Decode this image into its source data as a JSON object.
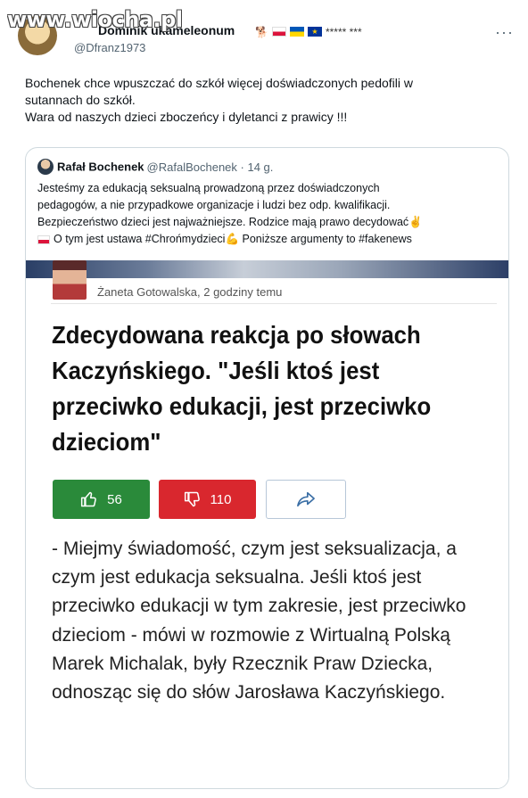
{
  "watermark": "www.wiocha.pl",
  "tweet": {
    "author_name": "Dominik ukameleonum",
    "author_stars": "***** ***",
    "author_handle": "@Dfranz1973",
    "text_line1": "Bochenek chce wpuszczać do szkół więcej doświadczonych pedofili w",
    "text_line2": "sutannach do szkół.",
    "text_line3": "Wara od naszych dzieci zboczeńcy i dyletanci z prawicy !!!"
  },
  "quote": {
    "name": "Rafał Bochenek",
    "handle": "@RafalBochenek · 14 g.",
    "line1": "Jesteśmy za edukacją seksualną prowadzoną przez doświadczonych",
    "line2": "pedagogów, a nie przypadkowe organizacje i ludzi bez odp. kwalifikacji.",
    "line3": "Bezpieczeństwo dzieci jest najważniejsze. Rodzice mają prawo decydować",
    "line4a": "O tym jest ustawa #Chrońmydzieci",
    "line4b": " Poniższe argumenty to #fakenews"
  },
  "article": {
    "author_line": "Żaneta Gotowalska, 2 godziny temu",
    "headline": "Zdecydowana reakcja po słowach Kaczyńskiego. \"Jeśli ktoś jest przeciwko edukacji, jest przeciwko dzieciom\"",
    "likes": "56",
    "dislikes": "110",
    "body": "- Miejmy świadomość, czym jest seksualizacja, a czym jest edukacja seksualna. Jeśli ktoś jest przeciwko edukacji w tym zakresie, jest przeciwko dzieciom - mówi w rozmowie z Wirtualną Polską Marek Michalak, były Rzecznik Praw Dziecka, odnosząc się do słów Jarosława Kaczyńskiego."
  },
  "colors": {
    "like": "#2a8a3a",
    "dislike": "#d9272e",
    "share_border": "#b7c7d8"
  }
}
